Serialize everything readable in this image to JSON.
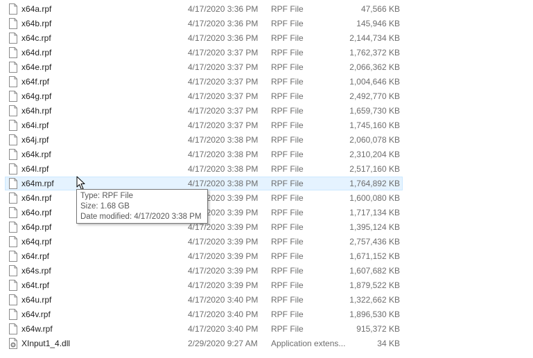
{
  "files": [
    {
      "name": "x64a.rpf",
      "date": "4/17/2020 3:36 PM",
      "type": "RPF File",
      "size": "47,566 KB",
      "icon": "file-icon"
    },
    {
      "name": "x64b.rpf",
      "date": "4/17/2020 3:36 PM",
      "type": "RPF File",
      "size": "145,946 KB",
      "icon": "file-icon"
    },
    {
      "name": "x64c.rpf",
      "date": "4/17/2020 3:36 PM",
      "type": "RPF File",
      "size": "2,144,734 KB",
      "icon": "file-icon"
    },
    {
      "name": "x64d.rpf",
      "date": "4/17/2020 3:37 PM",
      "type": "RPF File",
      "size": "1,762,372 KB",
      "icon": "file-icon"
    },
    {
      "name": "x64e.rpf",
      "date": "4/17/2020 3:37 PM",
      "type": "RPF File",
      "size": "2,066,362 KB",
      "icon": "file-icon"
    },
    {
      "name": "x64f.rpf",
      "date": "4/17/2020 3:37 PM",
      "type": "RPF File",
      "size": "1,004,646 KB",
      "icon": "file-icon"
    },
    {
      "name": "x64g.rpf",
      "date": "4/17/2020 3:37 PM",
      "type": "RPF File",
      "size": "2,492,770 KB",
      "icon": "file-icon"
    },
    {
      "name": "x64h.rpf",
      "date": "4/17/2020 3:37 PM",
      "type": "RPF File",
      "size": "1,659,730 KB",
      "icon": "file-icon"
    },
    {
      "name": "x64i.rpf",
      "date": "4/17/2020 3:37 PM",
      "type": "RPF File",
      "size": "1,745,160 KB",
      "icon": "file-icon"
    },
    {
      "name": "x64j.rpf",
      "date": "4/17/2020 3:38 PM",
      "type": "RPF File",
      "size": "2,060,078 KB",
      "icon": "file-icon"
    },
    {
      "name": "x64k.rpf",
      "date": "4/17/2020 3:38 PM",
      "type": "RPF File",
      "size": "2,310,204 KB",
      "icon": "file-icon"
    },
    {
      "name": "x64l.rpf",
      "date": "4/17/2020 3:38 PM",
      "type": "RPF File",
      "size": "2,517,160 KB",
      "icon": "file-icon"
    },
    {
      "name": "x64m.rpf",
      "date": "4/17/2020 3:38 PM",
      "type": "RPF File",
      "size": "1,764,892 KB",
      "icon": "file-icon",
      "hovered": true
    },
    {
      "name": "x64n.rpf",
      "date": "4/17/2020 3:39 PM",
      "type": "RPF File",
      "size": "1,600,080 KB",
      "icon": "file-icon"
    },
    {
      "name": "x64o.rpf",
      "date": "4/17/2020 3:39 PM",
      "type": "RPF File",
      "size": "1,717,134 KB",
      "icon": "file-icon"
    },
    {
      "name": "x64p.rpf",
      "date": "4/17/2020 3:39 PM",
      "type": "RPF File",
      "size": "1,395,124 KB",
      "icon": "file-icon"
    },
    {
      "name": "x64q.rpf",
      "date": "4/17/2020 3:39 PM",
      "type": "RPF File",
      "size": "2,757,436 KB",
      "icon": "file-icon"
    },
    {
      "name": "x64r.rpf",
      "date": "4/17/2020 3:39 PM",
      "type": "RPF File",
      "size": "1,671,152 KB",
      "icon": "file-icon"
    },
    {
      "name": "x64s.rpf",
      "date": "4/17/2020 3:39 PM",
      "type": "RPF File",
      "size": "1,607,682 KB",
      "icon": "file-icon"
    },
    {
      "name": "x64t.rpf",
      "date": "4/17/2020 3:39 PM",
      "type": "RPF File",
      "size": "1,879,522 KB",
      "icon": "file-icon"
    },
    {
      "name": "x64u.rpf",
      "date": "4/17/2020 3:40 PM",
      "type": "RPF File",
      "size": "1,322,662 KB",
      "icon": "file-icon"
    },
    {
      "name": "x64v.rpf",
      "date": "4/17/2020 3:40 PM",
      "type": "RPF File",
      "size": "1,896,530 KB",
      "icon": "file-icon"
    },
    {
      "name": "x64w.rpf",
      "date": "4/17/2020 3:40 PM",
      "type": "RPF File",
      "size": "915,372 KB",
      "icon": "file-icon"
    },
    {
      "name": "XInput1_4.dll",
      "date": "2/29/2020 9:27 AM",
      "type": "Application extens...",
      "size": "34 KB",
      "icon": "dll-gear-icon"
    }
  ],
  "tooltip": {
    "type_line": "Type: RPF File",
    "size_line": "Size: 1.68 GB",
    "date_line": "Date modified: 4/17/2020 3:38 PM"
  },
  "colors": {
    "hover_bg": "#e5f3ff",
    "hover_border": "#cce8ff",
    "meta_text": "#6d6d6d",
    "name_text": "#1e1e1e"
  }
}
